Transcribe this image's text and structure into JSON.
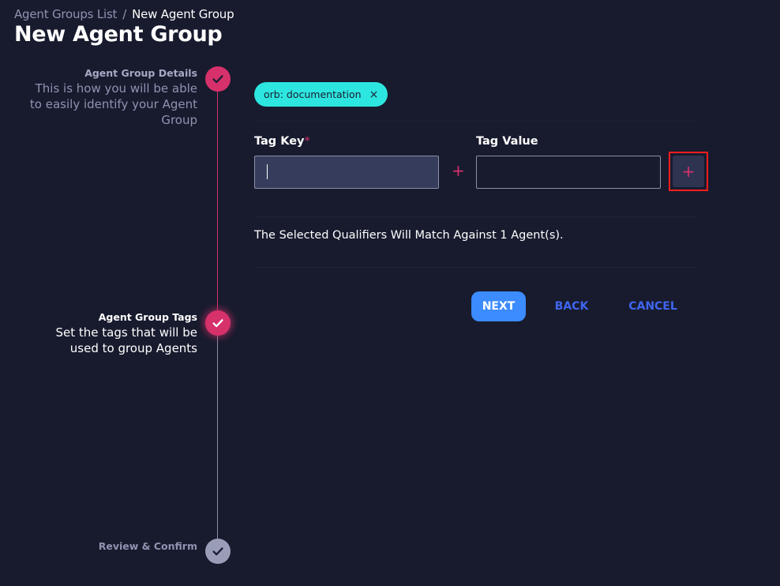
{
  "breadcrumb": {
    "parent": "Agent Groups List",
    "separator": "/",
    "current": "New Agent Group"
  },
  "page_title": "New Agent Group",
  "steps": [
    {
      "title": "Agent Group Details",
      "description": "This is how you will be able to easily identify your Agent Group",
      "state": "done"
    },
    {
      "title": "Agent Group Tags",
      "description": "Set the tags that will be used to group Agents",
      "state": "active"
    },
    {
      "title": "Review & Confirm",
      "description": "",
      "state": "todo"
    }
  ],
  "tag_chip": {
    "label": "orb: documentation",
    "close_icon": "×"
  },
  "form": {
    "tag_key_label": "Tag Key",
    "required_marker": "*",
    "tag_key_value": "",
    "tag_value_label": "Tag Value",
    "tag_value_value": "",
    "separator_icon": "+",
    "add_icon": "+"
  },
  "match_text": "The Selected Qualifiers Will Match Against 1 Agent(s).",
  "buttons": {
    "next": "NEXT",
    "back": "BACK",
    "cancel": "CANCEL"
  },
  "colors": {
    "background": "#181b2e",
    "accent": "#d6316b",
    "chip": "#2de6df",
    "primary": "#3c8bff",
    "link": "#3f66f0"
  }
}
